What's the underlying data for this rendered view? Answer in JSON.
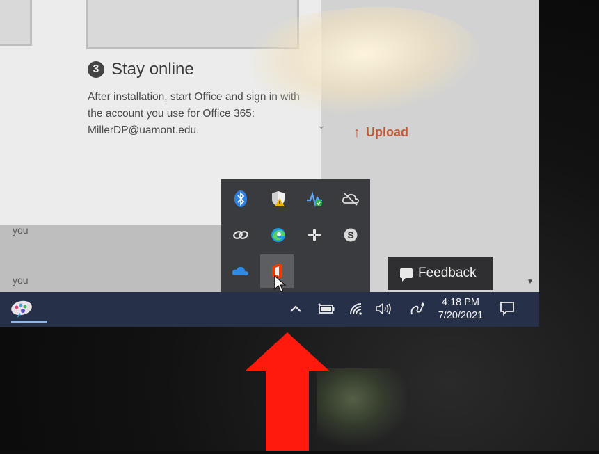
{
  "office_panel": {
    "step_number": "3",
    "step_title": "Stay online",
    "step_body": "After installation, start Office and sign in with the account you use for Office 365: MillerDP@uamont.edu."
  },
  "right_panel": {
    "upload_label": "Upload"
  },
  "list": {
    "row1": "you",
    "row2": "you"
  },
  "tray_popup": {
    "icons": [
      "bluetooth-icon",
      "windows-security-icon",
      "network-status-icon",
      "cloud-offline-icon",
      "link-icon",
      "edge-browser-icon",
      "slack-icon",
      "skype-icon",
      "onedrive-icon",
      "office-icon"
    ]
  },
  "feedback": {
    "label": "Feedback"
  },
  "taskbar": {
    "time": "4:18 PM",
    "date": "7/20/2021"
  },
  "colors": {
    "taskbar": "#263049",
    "tray_popup": "#3a3b3e",
    "upload_accent": "#c25a3a",
    "arrow": "#ff1a0d"
  }
}
